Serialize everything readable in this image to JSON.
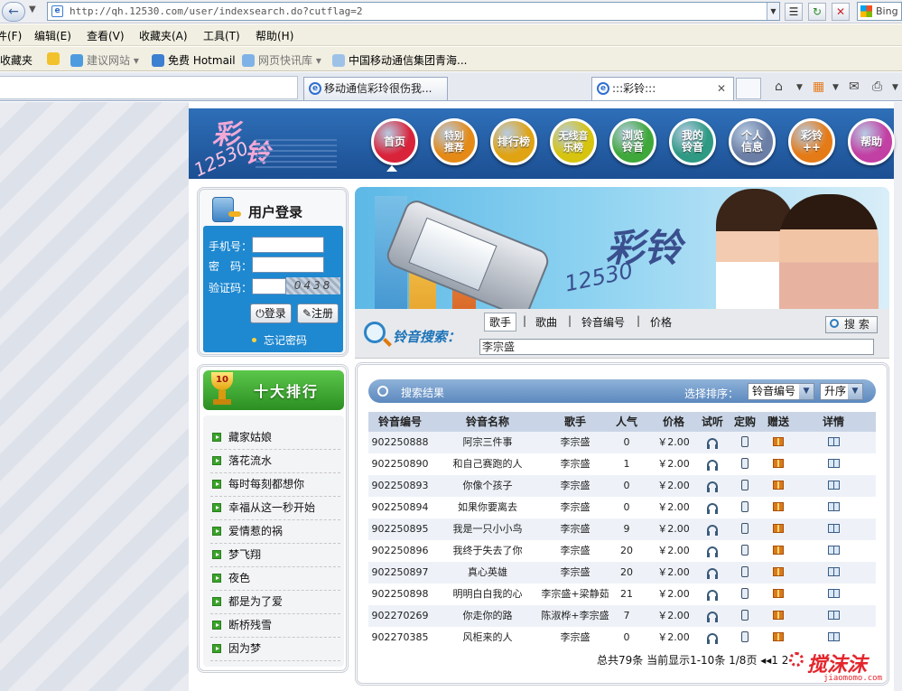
{
  "browser": {
    "url": "http://qh.12530.com/user/indexsearch.do?cutflag=2",
    "search_engine": "Bing",
    "menu": [
      "件(F)",
      "编辑(E)",
      "查看(V)",
      "收藏夹(A)",
      "工具(T)",
      "帮助(H)"
    ],
    "favorites_label": "收藏夹",
    "favorites": [
      {
        "label": "建议网站 ▾",
        "muted": true
      },
      {
        "label": "免费 Hotmail",
        "muted": false
      },
      {
        "label": "网页快讯库 ▾",
        "muted": true
      },
      {
        "label": "中国移动通信集团青海...",
        "muted": false
      }
    ],
    "tabs": [
      {
        "title": "移动通信彩玲很伤我...",
        "active": false
      },
      {
        "title": ":::彩铃:::",
        "active": true,
        "close": "✕"
      }
    ]
  },
  "nav": {
    "items": [
      {
        "label": "首页",
        "color": "#d9233a"
      },
      {
        "label": "特别推荐",
        "color": "#e58a16"
      },
      {
        "label": "排行榜",
        "color": "#e0a312"
      },
      {
        "label": "无线音乐榜",
        "color": "#d6c40f"
      },
      {
        "label": "浏览铃音",
        "color": "#3fa83a"
      },
      {
        "label": "我的铃音",
        "color": "#2e9a83"
      },
      {
        "label": "个人信息",
        "color": "#6b7fa6"
      },
      {
        "label": "彩铃++",
        "color": "#e57b17"
      },
      {
        "label": "帮助",
        "color": "#c23fa3"
      }
    ]
  },
  "login": {
    "title": "用户登录",
    "phone_label": "手机号：",
    "password_label": "密　码：",
    "captcha_label": "验证码：",
    "captcha_text": "0438",
    "login_button": "登录",
    "register_button": "注册",
    "forgot": "忘记密码"
  },
  "ranking": {
    "title": "十大排行",
    "trophy_number": "10",
    "items": [
      "藏家姑娘",
      "落花流水",
      "每时每刻都想你",
      "幸福从这一秒开始",
      "爱情惹的祸",
      "梦飞翔",
      "夜色",
      "都是为了爱",
      "断桥残雪",
      "因为梦"
    ]
  },
  "search": {
    "label": "铃音搜索：",
    "tabs": [
      "歌手",
      "歌曲",
      "铃音编号",
      "价格"
    ],
    "active_tab": "歌手",
    "button": "搜 索",
    "query": "李宗盛"
  },
  "results": {
    "title": "搜索结果",
    "sort_label": "选择排序：",
    "sort_field": "铃音编号",
    "sort_order": "升序",
    "columns": [
      "铃音编号",
      "铃音名称",
      "歌手",
      "人气",
      "价格",
      "试听",
      "定购",
      "赠送",
      "详情"
    ],
    "rows": [
      {
        "id": "902250888",
        "name": "阿宗三件事",
        "singer": "李宗盛",
        "pop": "0",
        "price": "￥2.00"
      },
      {
        "id": "902250890",
        "name": "和自己赛跑的人",
        "singer": "李宗盛",
        "pop": "1",
        "price": "￥2.00"
      },
      {
        "id": "902250893",
        "name": "你像个孩子",
        "singer": "李宗盛",
        "pop": "0",
        "price": "￥2.00"
      },
      {
        "id": "902250894",
        "name": "如果你要离去",
        "singer": "李宗盛",
        "pop": "0",
        "price": "￥2.00"
      },
      {
        "id": "902250895",
        "name": "我是一只小小鸟",
        "singer": "李宗盛",
        "pop": "9",
        "price": "￥2.00"
      },
      {
        "id": "902250896",
        "name": "我终于失去了你",
        "singer": "李宗盛",
        "pop": "20",
        "price": "￥2.00"
      },
      {
        "id": "902250897",
        "name": "真心英雄",
        "singer": "李宗盛",
        "pop": "20",
        "price": "￥2.00"
      },
      {
        "id": "902250898",
        "name": "明明白白我的心",
        "singer": "李宗盛+梁静茹",
        "pop": "21",
        "price": "￥2.00"
      },
      {
        "id": "902270269",
        "name": "你走你的路",
        "singer": "陈淑桦+李宗盛",
        "pop": "7",
        "price": "￥2.00"
      },
      {
        "id": "902270385",
        "name": "风柜来的人",
        "singer": "李宗盛",
        "pop": "0",
        "price": "￥2.00"
      }
    ],
    "pager": "总共79条  当前显示1-10条  1/8页 ◂◂1  2"
  },
  "watermark": {
    "brand": "搅沫沫",
    "url": "jiaomomo.com"
  }
}
